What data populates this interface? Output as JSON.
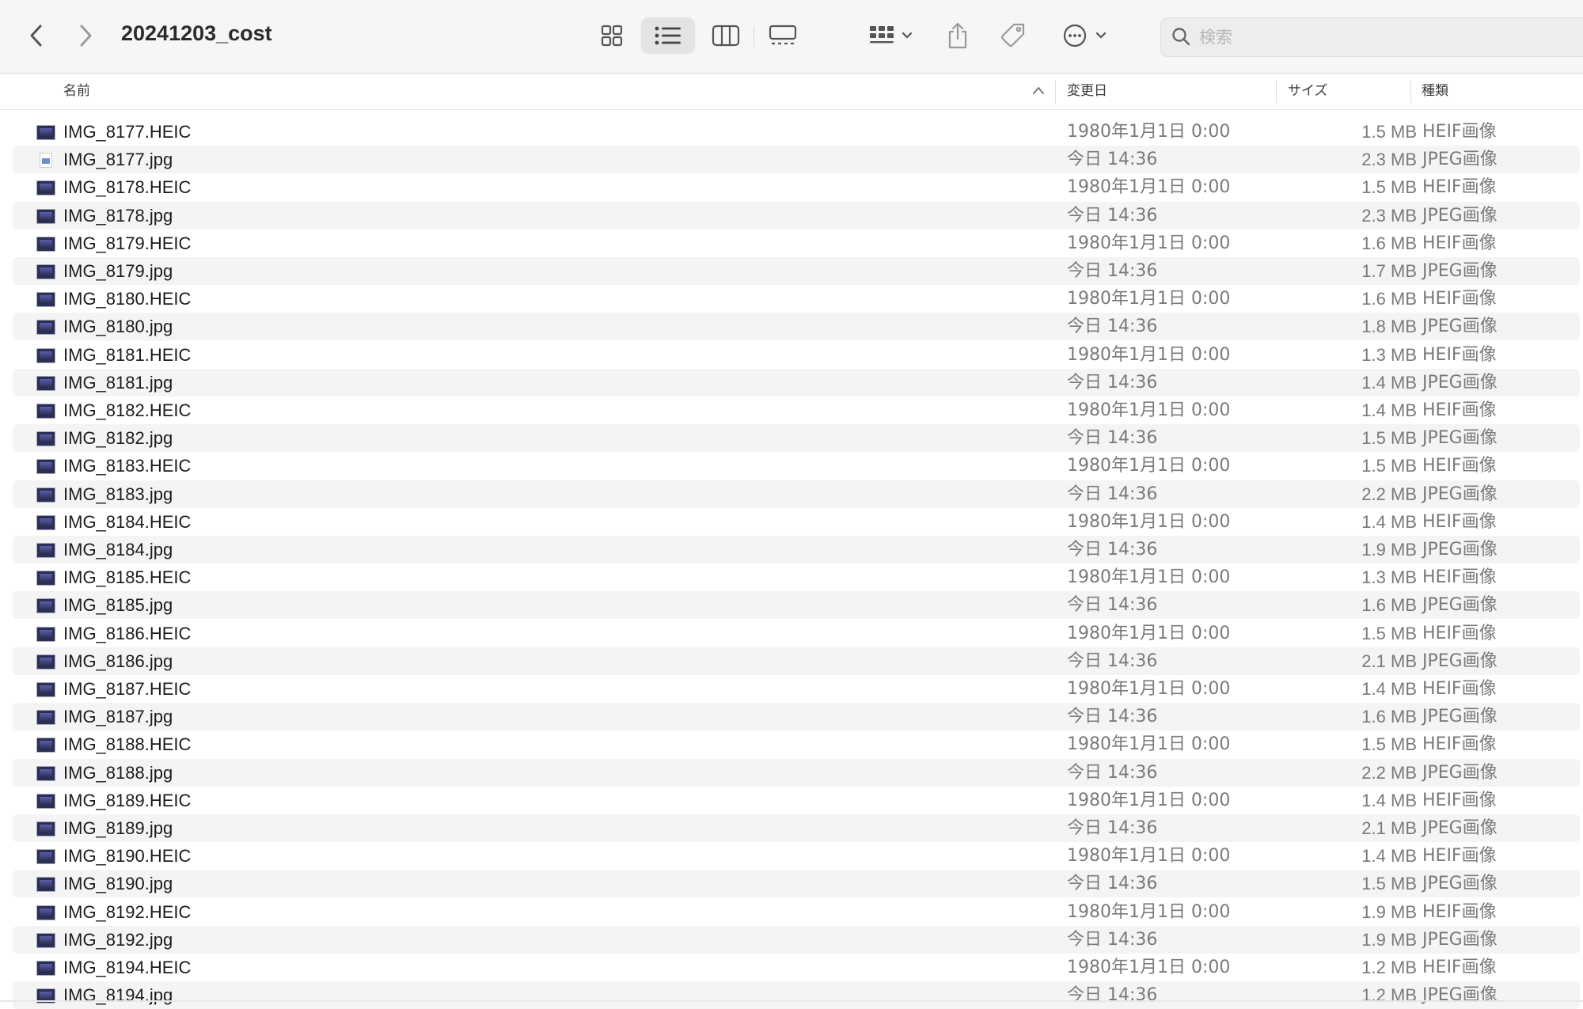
{
  "window": {
    "title": "20241203_cost"
  },
  "toolbar": {
    "back_icon": "chevron-left-icon",
    "forward_icon": "chevron-right-icon",
    "view_modes": [
      "icon-view",
      "list-view",
      "column-view",
      "gallery-view"
    ],
    "selected_view": "list-view",
    "group_icon": "group-by-icon",
    "share_icon": "share-icon",
    "tag_icon": "tag-icon",
    "more_icon": "more-actions-icon"
  },
  "search": {
    "placeholder": "検索",
    "value": ""
  },
  "columns": {
    "name": "名前",
    "modified": "変更日",
    "size": "サイズ",
    "kind": "種類"
  },
  "files": [
    {
      "name": "IMG_8177.HEIC",
      "modified": "1980年1月1日 0:00",
      "size": "1.5 MB",
      "kind": "HEIF画像",
      "icon": "image-thumbnail-icon"
    },
    {
      "name": "IMG_8177.jpg",
      "modified": "今日 14:36",
      "size": "2.3 MB",
      "kind": "JPEG画像",
      "icon": "document-thumbnail-icon"
    },
    {
      "name": "IMG_8178.HEIC",
      "modified": "1980年1月1日 0:00",
      "size": "1.5 MB",
      "kind": "HEIF画像",
      "icon": "image-thumbnail-icon"
    },
    {
      "name": "IMG_8178.jpg",
      "modified": "今日 14:36",
      "size": "2.3 MB",
      "kind": "JPEG画像",
      "icon": "image-thumbnail-icon"
    },
    {
      "name": "IMG_8179.HEIC",
      "modified": "1980年1月1日 0:00",
      "size": "1.6 MB",
      "kind": "HEIF画像",
      "icon": "image-thumbnail-icon"
    },
    {
      "name": "IMG_8179.jpg",
      "modified": "今日 14:36",
      "size": "1.7 MB",
      "kind": "JPEG画像",
      "icon": "image-thumbnail-icon"
    },
    {
      "name": "IMG_8180.HEIC",
      "modified": "1980年1月1日 0:00",
      "size": "1.6 MB",
      "kind": "HEIF画像",
      "icon": "image-thumbnail-icon"
    },
    {
      "name": "IMG_8180.jpg",
      "modified": "今日 14:36",
      "size": "1.8 MB",
      "kind": "JPEG画像",
      "icon": "image-thumbnail-icon"
    },
    {
      "name": "IMG_8181.HEIC",
      "modified": "1980年1月1日 0:00",
      "size": "1.3 MB",
      "kind": "HEIF画像",
      "icon": "image-thumbnail-icon"
    },
    {
      "name": "IMG_8181.jpg",
      "modified": "今日 14:36",
      "size": "1.4 MB",
      "kind": "JPEG画像",
      "icon": "image-thumbnail-icon"
    },
    {
      "name": "IMG_8182.HEIC",
      "modified": "1980年1月1日 0:00",
      "size": "1.4 MB",
      "kind": "HEIF画像",
      "icon": "image-thumbnail-icon"
    },
    {
      "name": "IMG_8182.jpg",
      "modified": "今日 14:36",
      "size": "1.5 MB",
      "kind": "JPEG画像",
      "icon": "image-thumbnail-icon"
    },
    {
      "name": "IMG_8183.HEIC",
      "modified": "1980年1月1日 0:00",
      "size": "1.5 MB",
      "kind": "HEIF画像",
      "icon": "image-thumbnail-icon"
    },
    {
      "name": "IMG_8183.jpg",
      "modified": "今日 14:36",
      "size": "2.2 MB",
      "kind": "JPEG画像",
      "icon": "image-thumbnail-icon"
    },
    {
      "name": "IMG_8184.HEIC",
      "modified": "1980年1月1日 0:00",
      "size": "1.4 MB",
      "kind": "HEIF画像",
      "icon": "image-thumbnail-icon"
    },
    {
      "name": "IMG_8184.jpg",
      "modified": "今日 14:36",
      "size": "1.9 MB",
      "kind": "JPEG画像",
      "icon": "image-thumbnail-icon"
    },
    {
      "name": "IMG_8185.HEIC",
      "modified": "1980年1月1日 0:00",
      "size": "1.3 MB",
      "kind": "HEIF画像",
      "icon": "image-thumbnail-icon"
    },
    {
      "name": "IMG_8185.jpg",
      "modified": "今日 14:36",
      "size": "1.6 MB",
      "kind": "JPEG画像",
      "icon": "image-thumbnail-icon"
    },
    {
      "name": "IMG_8186.HEIC",
      "modified": "1980年1月1日 0:00",
      "size": "1.5 MB",
      "kind": "HEIF画像",
      "icon": "image-thumbnail-icon"
    },
    {
      "name": "IMG_8186.jpg",
      "modified": "今日 14:36",
      "size": "2.1 MB",
      "kind": "JPEG画像",
      "icon": "image-thumbnail-icon"
    },
    {
      "name": "IMG_8187.HEIC",
      "modified": "1980年1月1日 0:00",
      "size": "1.4 MB",
      "kind": "HEIF画像",
      "icon": "image-thumbnail-icon"
    },
    {
      "name": "IMG_8187.jpg",
      "modified": "今日 14:36",
      "size": "1.6 MB",
      "kind": "JPEG画像",
      "icon": "image-thumbnail-icon"
    },
    {
      "name": "IMG_8188.HEIC",
      "modified": "1980年1月1日 0:00",
      "size": "1.5 MB",
      "kind": "HEIF画像",
      "icon": "image-thumbnail-icon"
    },
    {
      "name": "IMG_8188.jpg",
      "modified": "今日 14:36",
      "size": "2.2 MB",
      "kind": "JPEG画像",
      "icon": "image-thumbnail-icon"
    },
    {
      "name": "IMG_8189.HEIC",
      "modified": "1980年1月1日 0:00",
      "size": "1.4 MB",
      "kind": "HEIF画像",
      "icon": "image-thumbnail-icon"
    },
    {
      "name": "IMG_8189.jpg",
      "modified": "今日 14:36",
      "size": "2.1 MB",
      "kind": "JPEG画像",
      "icon": "image-thumbnail-icon"
    },
    {
      "name": "IMG_8190.HEIC",
      "modified": "1980年1月1日 0:00",
      "size": "1.4 MB",
      "kind": "HEIF画像",
      "icon": "image-thumbnail-icon"
    },
    {
      "name": "IMG_8190.jpg",
      "modified": "今日 14:36",
      "size": "1.5 MB",
      "kind": "JPEG画像",
      "icon": "image-thumbnail-icon"
    },
    {
      "name": "IMG_8192.HEIC",
      "modified": "1980年1月1日 0:00",
      "size": "1.9 MB",
      "kind": "HEIF画像",
      "icon": "image-thumbnail-icon"
    },
    {
      "name": "IMG_8192.jpg",
      "modified": "今日 14:36",
      "size": "1.9 MB",
      "kind": "JPEG画像",
      "icon": "image-thumbnail-icon"
    },
    {
      "name": "IMG_8194.HEIC",
      "modified": "1980年1月1日 0:00",
      "size": "1.2 MB",
      "kind": "HEIF画像",
      "icon": "image-thumbnail-icon"
    },
    {
      "name": "IMG_8194.jpg",
      "modified": "今日 14:36",
      "size": "1.2 MB",
      "kind": "JPEG画像",
      "icon": "image-thumbnail-icon"
    }
  ],
  "colors": {
    "toolbar_bg": "#f6f6f6",
    "row_alt_bg": "#f4f4f4",
    "secondary_text": "#7a7a7a"
  }
}
